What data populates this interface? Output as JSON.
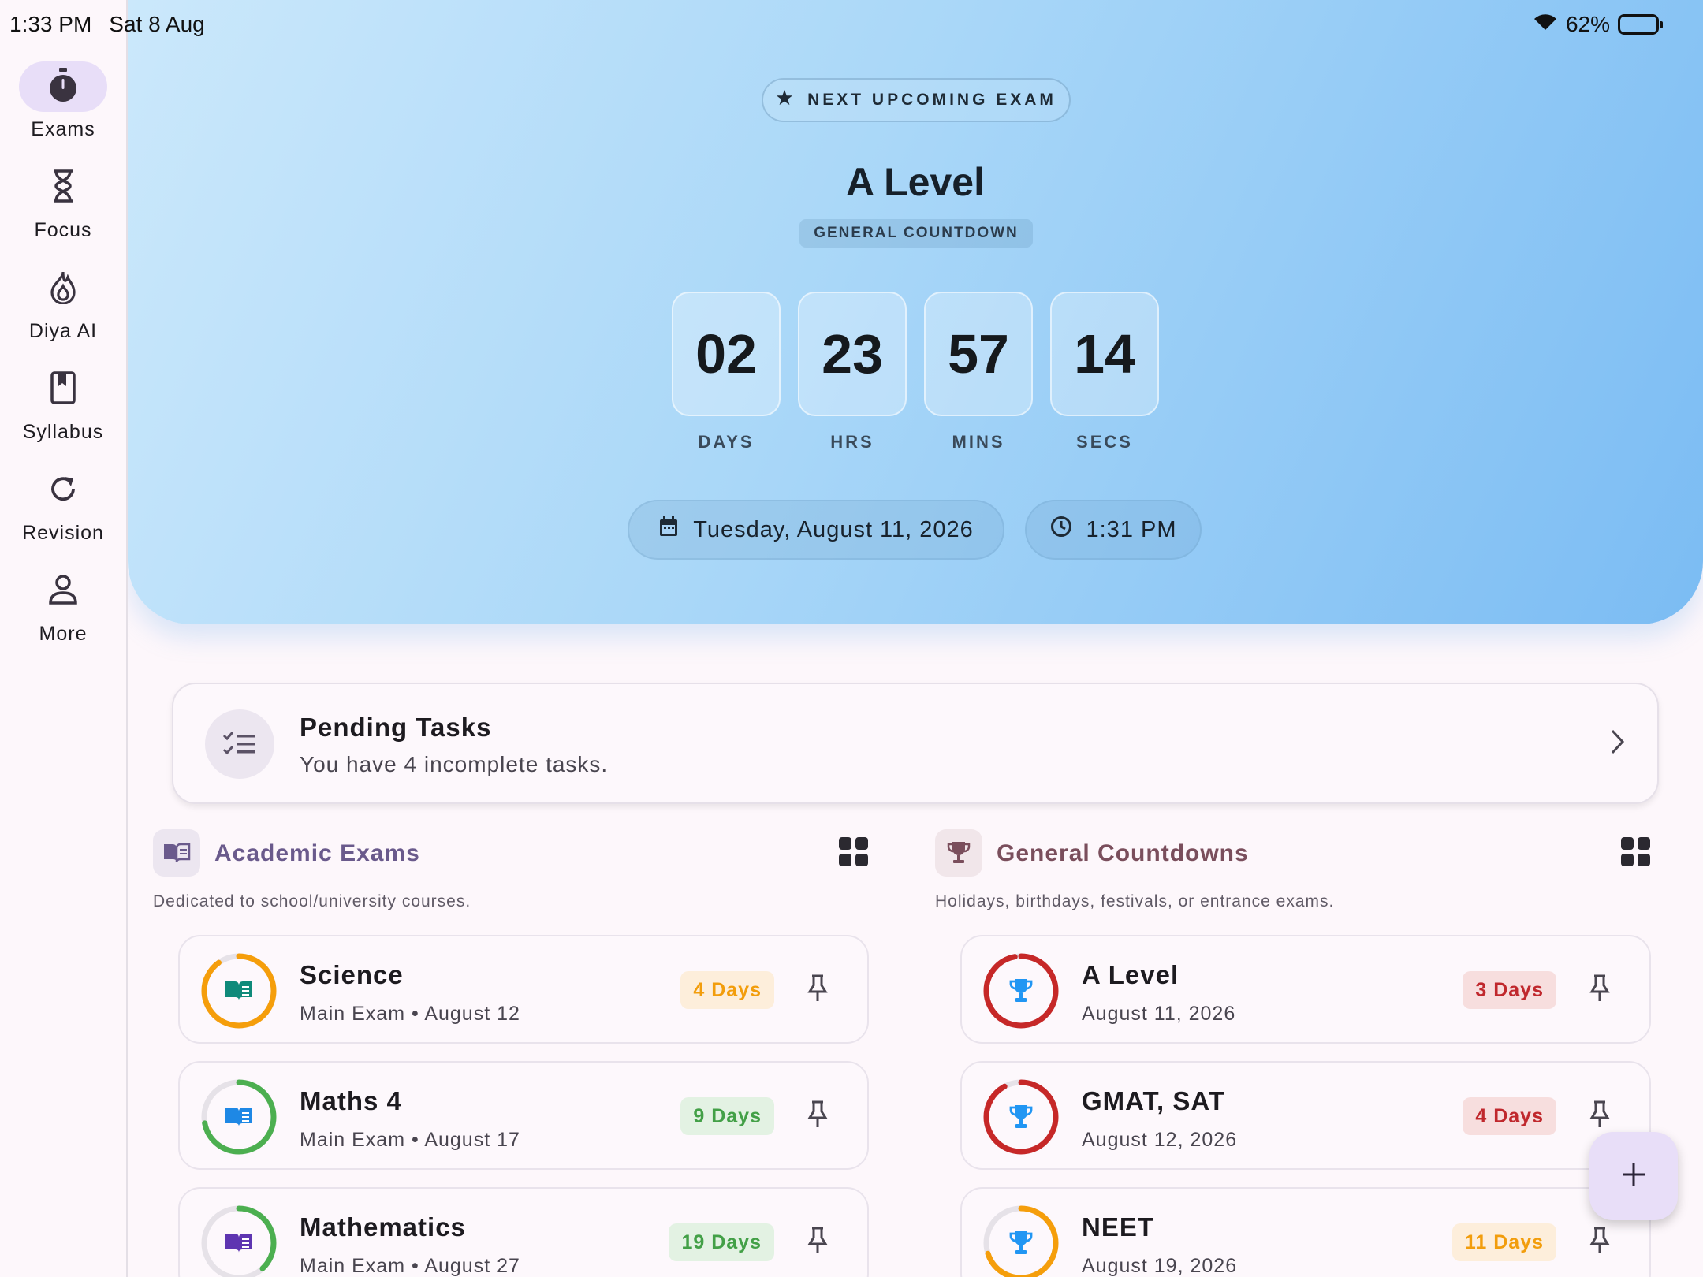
{
  "status": {
    "time": "1:33 PM",
    "date": "Sat 8 Aug",
    "battery": "62%",
    "battery_level": 0.62
  },
  "rail": {
    "items": [
      {
        "label": "Exams",
        "icon": "stopwatch-icon",
        "active": true
      },
      {
        "label": "Focus",
        "icon": "hourglass-icon"
      },
      {
        "label": "Diya AI",
        "icon": "flame-icon"
      },
      {
        "label": "Syllabus",
        "icon": "bookmark-book-icon"
      },
      {
        "label": "Revision",
        "icon": "refresh-icon"
      },
      {
        "label": "More",
        "icon": "person-icon"
      }
    ]
  },
  "hero": {
    "chip": "NEXT UPCOMING EXAM",
    "title": "A Level",
    "tag": "GENERAL COUNTDOWN",
    "countdown": [
      {
        "value": "02",
        "label": "DAYS"
      },
      {
        "value": "23",
        "label": "HRS"
      },
      {
        "value": "57",
        "label": "MINS"
      },
      {
        "value": "14",
        "label": "SECS"
      }
    ],
    "date": "Tuesday, August 11, 2026",
    "time": "1:31 PM"
  },
  "tasks": {
    "title": "Pending Tasks",
    "subtitle": "You have 4 incomplete tasks."
  },
  "academic": {
    "title": "Academic Exams",
    "desc": "Dedicated to school/university courses.",
    "items": [
      {
        "title": "Science",
        "type": "Main Exam",
        "date": "August 12",
        "days": "4 Days",
        "color": "#f59e0b",
        "iconColor": "#0f8a7a",
        "progress": 0.9
      },
      {
        "title": "Maths 4",
        "type": "Main Exam",
        "date": "August 17",
        "days": "9 Days",
        "color": "#4caf50",
        "iconColor": "#1e88e5",
        "progress": 0.72
      },
      {
        "title": "Mathematics",
        "type": "Main Exam",
        "date": "August 27",
        "days": "19 Days",
        "color": "#4caf50",
        "iconColor": "#5e35b1",
        "progress": 0.38
      }
    ]
  },
  "general": {
    "title": "General Countdowns",
    "desc": "Holidays, birthdays, festivals, or entrance exams.",
    "items": [
      {
        "title": "A Level",
        "date": "August 11, 2026",
        "days": "3 Days",
        "color": "#c62828",
        "progress": 0.97
      },
      {
        "title": "GMAT, SAT",
        "date": "August 12, 2026",
        "days": "4 Days",
        "color": "#c62828",
        "progress": 0.92
      },
      {
        "title": "NEET",
        "date": "August 19, 2026",
        "days": "11 Days",
        "color": "#f59e0b",
        "progress": 0.7
      }
    ]
  },
  "colors": {
    "accent": "#6750a4",
    "hero_start": "#cbe8fb",
    "hero_end": "#7bbcf3",
    "trophy": "#2196f3"
  }
}
